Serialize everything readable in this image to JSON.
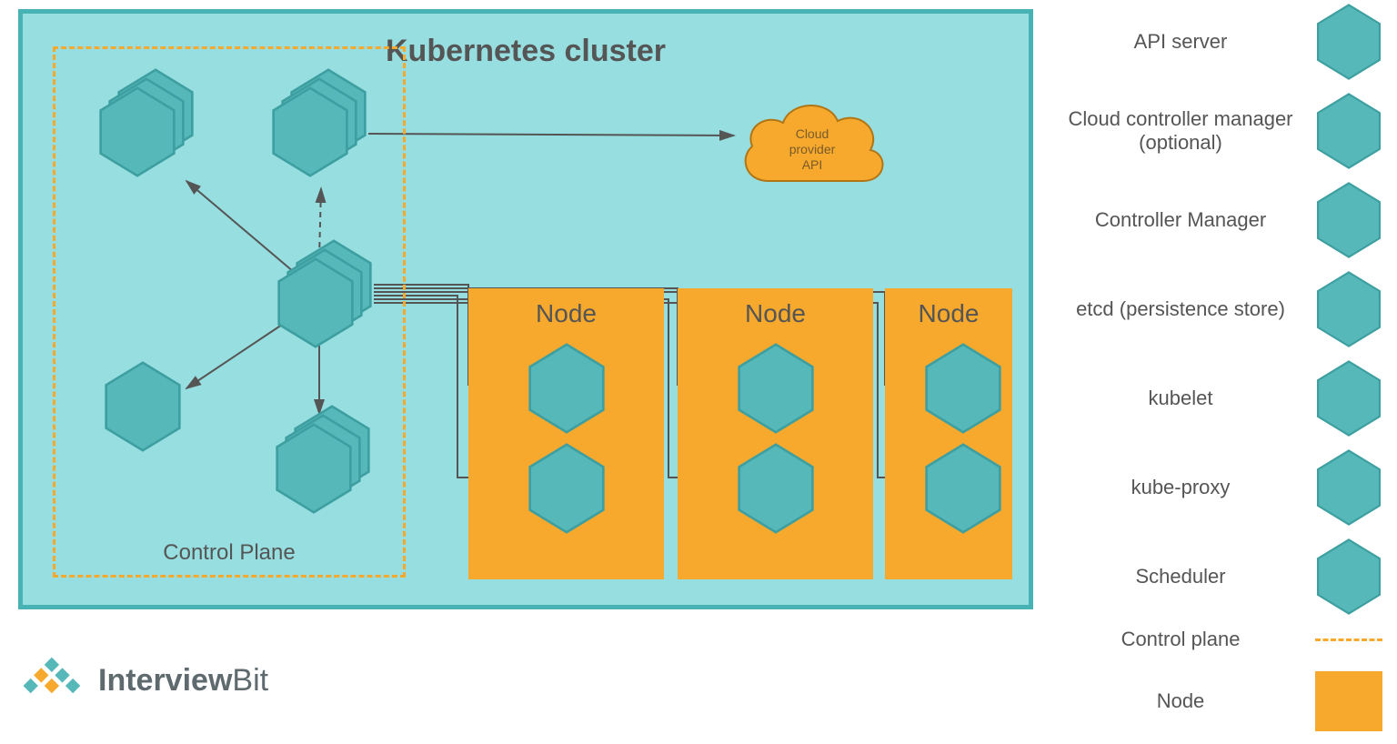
{
  "diagram": {
    "title": "Kubernetes cluster",
    "controlPlaneLabel": "Control Plane",
    "cloud": {
      "line1": "Cloud",
      "line2": "provider",
      "line3": "API"
    },
    "nodes": [
      {
        "label": "Node"
      },
      {
        "label": "Node"
      },
      {
        "label": "Node"
      }
    ]
  },
  "legend": {
    "items": [
      {
        "label": "API server",
        "type": "hex"
      },
      {
        "label": "Cloud controller manager (optional)",
        "type": "hex"
      },
      {
        "label": "Controller Manager",
        "type": "hex"
      },
      {
        "label": "etcd (persistence store)",
        "type": "hex"
      },
      {
        "label": "kubelet",
        "type": "hex"
      },
      {
        "label": "kube-proxy",
        "type": "hex"
      },
      {
        "label": "Scheduler",
        "type": "hex"
      },
      {
        "label": "Control plane",
        "type": "dash"
      },
      {
        "label": "Node",
        "type": "square"
      }
    ]
  },
  "brand": {
    "part1": "Interview",
    "part2": "Bit"
  },
  "colors": {
    "teal": "#57B8BA",
    "tealDark": "#3E9FA1",
    "orange": "#F6A92D",
    "bg": "#97DEE0",
    "border": "#48B3B5"
  }
}
